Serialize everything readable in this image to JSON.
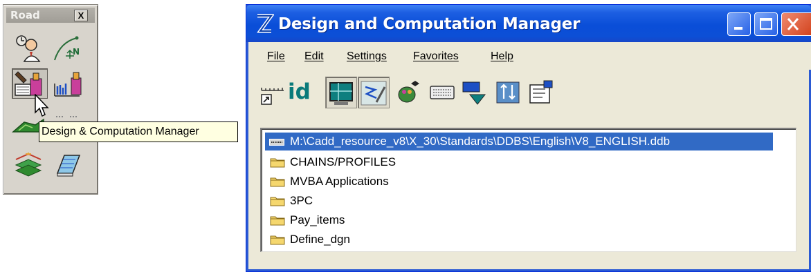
{
  "road_toolbox": {
    "title": "Road",
    "close_label": "X",
    "tools": [
      {
        "name": "surveyor-icon",
        "pressed": false
      },
      {
        "name": "geometry-icon",
        "pressed": false
      },
      {
        "name": "design-computation-manager-icon",
        "pressed": true
      },
      {
        "name": "roadway-designer-icon",
        "pressed": false
      },
      {
        "name": "terrain-icon",
        "pressed": false
      },
      {
        "name": "cross-sections-icon",
        "pressed": false
      },
      {
        "name": "layers-icon",
        "pressed": false
      },
      {
        "name": "notebook-icon",
        "pressed": false
      }
    ],
    "tooltip": "Design & Computation Manager"
  },
  "window": {
    "title": "Design and Computation Manager",
    "menu": [
      "File",
      "Edit",
      "Settings",
      "Favorites",
      "Help"
    ],
    "toolbar": {
      "id_label": "id",
      "tools": [
        "ruler-icon",
        "id-icon",
        "monitor-icon",
        "draw-mode-icon",
        "palette-icon",
        "keyboard-icon",
        "select-icon",
        "sort-icon",
        "properties-icon"
      ]
    },
    "tree": {
      "root": "M:\\Cadd_resource_v8\\X_30\\Standards\\DDBS\\English\\V8_ENGLISH.ddb",
      "folders": [
        "CHAINS/PROFILES",
        "MVBA Applications",
        "3PC",
        "Pay_items",
        "Define_dgn"
      ]
    }
  },
  "colors": {
    "titlebar_blue": "#0a4ed8",
    "selection_blue": "#316ac5",
    "close_red": "#d2421d",
    "tooltip_bg": "#ffffe1",
    "folder_yellow": "#f5d76e"
  }
}
